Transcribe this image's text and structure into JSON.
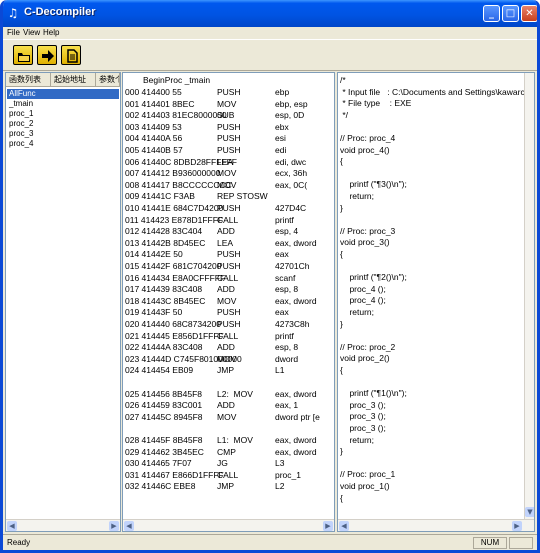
{
  "window": {
    "title": "C-Decompiler",
    "app_icon": "app-icon",
    "minimize": "_",
    "maximize": "□",
    "close": "✕"
  },
  "menu": [
    "File",
    "View",
    "Help"
  ],
  "toolbar": {
    "buttons": [
      {
        "icon": "open-folder-icon"
      },
      {
        "icon": "decompile-arrow-icon"
      },
      {
        "icon": "document-icon"
      }
    ]
  },
  "function_list": {
    "columns": [
      "函数列表",
      "起始地址",
      "参数个"
    ],
    "rows": [
      "AllFunc",
      "_tmain",
      "proc_1",
      "proc_2",
      "proc_3",
      "proc_4"
    ],
    "selected": "AllFunc"
  },
  "assembly": {
    "header": "BeginProc _tmain",
    "lines": [
      {
        "addr": "000 414400 55",
        "mn": "PUSH",
        "op": "ebp"
      },
      {
        "addr": "001 414401 8BEC",
        "mn": "MOV",
        "op": "ebp, esp"
      },
      {
        "addr": "002 414403 81EC8000000",
        "mn": "SUB",
        "op": "esp, 0D"
      },
      {
        "addr": "003 414409 53",
        "mn": "PUSH",
        "op": "ebx"
      },
      {
        "addr": "004 41440A 56",
        "mn": "PUSH",
        "op": "esi"
      },
      {
        "addr": "005 41440B 57",
        "mn": "PUSH",
        "op": "edi"
      },
      {
        "addr": "006 41440C 8DBD28FFFFFF",
        "mn": "LEA",
        "op": "edi, dwc"
      },
      {
        "addr": "007 414412 B936000000",
        "mn": "MOV",
        "op": "ecx, 36h"
      },
      {
        "addr": "008 414417 B8CCCCCCCC",
        "mn": "MOV",
        "op": "eax, 0C("
      },
      {
        "addr": "009 41441C F3AB",
        "mn": "REP STOSW",
        "op": ""
      },
      {
        "addr": "010 41441E 684C7D4200",
        "mn": "PUSH",
        "op": "427D4C"
      },
      {
        "addr": "011 414423 E878D1FFFF",
        "mn": "CALL",
        "op": "printf"
      },
      {
        "addr": "012 414428 83C404",
        "mn": "ADD",
        "op": "esp, 4"
      },
      {
        "addr": "013 41442B 8D45EC",
        "mn": "LEA",
        "op": "eax, dword"
      },
      {
        "addr": "014 41442E 50",
        "mn": "PUSH",
        "op": "eax"
      },
      {
        "addr": "015 41442F 681C704200",
        "mn": "PUSH",
        "op": "42701Ch"
      },
      {
        "addr": "016 414434 E8A0CFFFFF",
        "mn": "CALL",
        "op": "scanf"
      },
      {
        "addr": "017 414439 83C408",
        "mn": "ADD",
        "op": "esp, 8"
      },
      {
        "addr": "018 41443C 8B45EC",
        "mn": "MOV",
        "op": "eax, dword"
      },
      {
        "addr": "019 41443F 50",
        "mn": "PUSH",
        "op": "eax"
      },
      {
        "addr": "020 414440 68C8734200",
        "mn": "PUSH",
        "op": "4273C8h"
      },
      {
        "addr": "021 414445 E856D1FFFF",
        "mn": "CALL",
        "op": "printf"
      },
      {
        "addr": "022 41444A 83C408",
        "mn": "ADD",
        "op": "esp, 8"
      },
      {
        "addr": "023 41444D C745F801000000",
        "mn": "MOV",
        "op": "dword"
      },
      {
        "addr": "024 414454 EB09",
        "mn": "JMP",
        "op": "L1"
      },
      {
        "addr": "",
        "mn": "",
        "op": ""
      },
      {
        "addr": "025 414456 8B45F8",
        "mn": "L2:  MOV",
        "op": "eax, dword"
      },
      {
        "addr": "026 414459 83C001",
        "mn": "ADD",
        "op": "eax, 1"
      },
      {
        "addr": "027 41445C 8945F8",
        "mn": "MOV",
        "op": "dword ptr [e"
      },
      {
        "addr": "",
        "mn": "",
        "op": ""
      },
      {
        "addr": "028 41445F 8B45F8",
        "mn": "L1:  MOV",
        "op": "eax, dword"
      },
      {
        "addr": "029 414462 3B45EC",
        "mn": "CMP",
        "op": "eax, dword"
      },
      {
        "addr": "030 414465 7F07",
        "mn": "JG",
        "op": "L3"
      },
      {
        "addr": "031 414467 E866D1FFFF",
        "mn": "CALL",
        "op": "proc_1"
      },
      {
        "addr": "032 41446C EBE8",
        "mn": "JMP",
        "op": "L2"
      }
    ]
  },
  "source": {
    "lines": [
      "/*",
      " * Input file   : C:\\Documents and Settings\\kawarchen",
      " * File type    : EXE",
      " */",
      "",
      "// Proc: proc_4",
      "void proc_4()",
      "{",
      "",
      "    printf (\"¶3()\\n\");",
      "    return;",
      "}",
      "",
      "// Proc: proc_3",
      "void proc_3()",
      "{",
      "",
      "    printf (\"¶2()\\n\");",
      "    proc_4 ();",
      "    proc_4 ();",
      "    return;",
      "}",
      "",
      "// Proc: proc_2",
      "void proc_2()",
      "{",
      "",
      "    printf (\"¶1()\\n\");",
      "    proc_3 ();",
      "    proc_3 ();",
      "    proc_3 ();",
      "    return;",
      "}",
      "",
      "// Proc: proc_1",
      "void proc_1()",
      "{"
    ]
  },
  "status": {
    "text": "Ready",
    "num": "NUM"
  }
}
